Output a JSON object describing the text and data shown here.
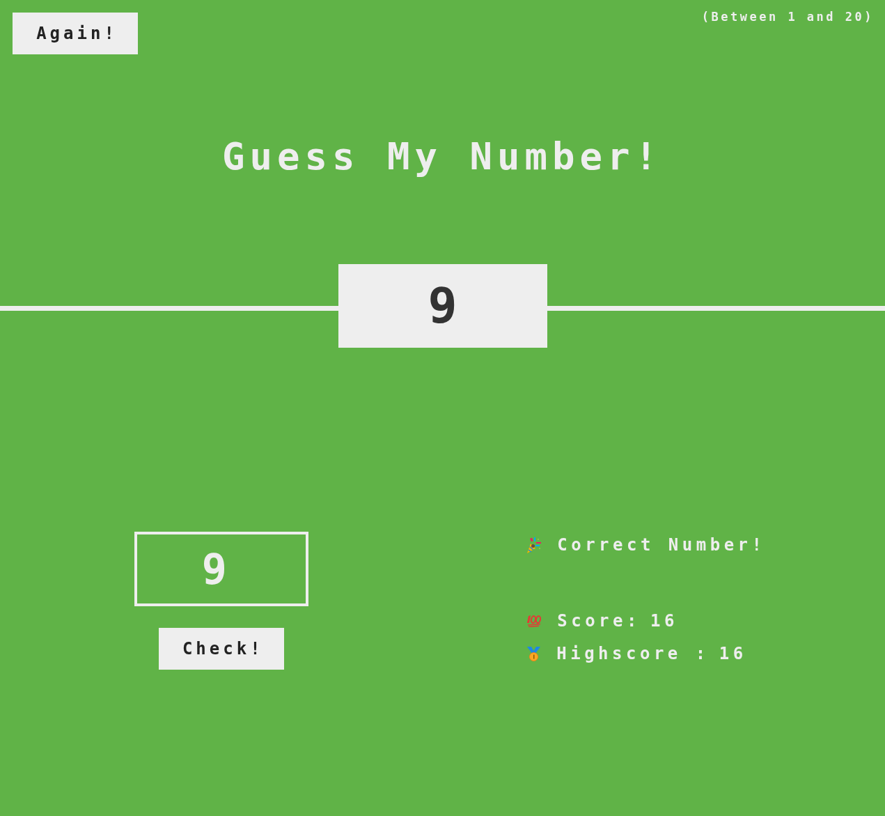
{
  "header": {
    "again_button": "Again!",
    "range_hint": "(Between 1 and 20)",
    "title": "Guess My Number!"
  },
  "result": {
    "won": true,
    "secret_number": "9",
    "message": "Correct Number!"
  },
  "guess_input": {
    "value": "9"
  },
  "check_button": "Check!",
  "stats": [
    {
      "kind": "score",
      "label": "Score:",
      "value": "16"
    },
    {
      "kind": "highscore",
      "label": "Highscore :",
      "value": "16"
    }
  ]
}
